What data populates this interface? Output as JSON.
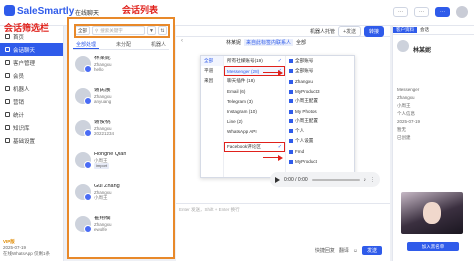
{
  "topbar": {
    "logo": "SaleSmartly",
    "online_tab": "在线聊天",
    "pills": [
      "···",
      "···",
      "···"
    ]
  },
  "sidebar": {
    "items": [
      {
        "label": "首页"
      },
      {
        "label": "会话聊天"
      },
      {
        "label": "客户管理"
      },
      {
        "label": "会员"
      },
      {
        "label": "机器人"
      },
      {
        "label": "营销"
      },
      {
        "label": "统计"
      },
      {
        "label": "知识库"
      },
      {
        "label": "基础设置"
      }
    ],
    "plan_tier": "VIP版",
    "plan_date": "2025-07-19",
    "plan_note": "在线WhatsApp 仅剩1条"
  },
  "annotations": {
    "filter_label": "会话筛选栏",
    "list_label": "会话列表"
  },
  "convlist": {
    "filter_select": "全部",
    "search_placeholder": "搜索关键字",
    "tabs": [
      "全部处理",
      "未分配",
      "机器人"
    ],
    "conversations": [
      {
        "name": "林某妮",
        "line1": "Zhangxu",
        "line2": "hello"
      },
      {
        "name": "谢民展",
        "line1": "Zhangxu",
        "line2": "anyuang"
      },
      {
        "name": "谢俊桃",
        "line1": "Zhangxu",
        "line2": "20221234"
      },
      {
        "name": "Honghe Qian",
        "line1": "小周王",
        "line2": "import"
      },
      {
        "name": "Gui Zhang",
        "line1": "Zhangxu",
        "line2": "小周王"
      },
      {
        "name": "霍翔楠",
        "line1": "Zhangxu",
        "line2": "ewolfe"
      }
    ]
  },
  "chat": {
    "head_items": [
      "机器人托管",
      "+发送",
      "转接"
    ],
    "title_name": "林某妮",
    "title_tag": "来自此标签内联系人",
    "title_tag2": "全部"
  },
  "dropdown": {
    "col1": [
      "全部",
      "平道",
      "来因"
    ],
    "col2": [
      "所有社媒账号(19)",
      "Messenger (28)",
      "聊天插件 (18)",
      "Email (6)",
      "Telegram (3)",
      "Instagram (10)",
      "Line (2)",
      "WhatsApp API",
      "Facebook评论区"
    ],
    "col3": [
      "全部账号",
      "全部账号",
      "Zhangxu",
      "MyProduct3",
      "小周王配置",
      "My Photos",
      "小周王配置",
      "个人",
      "个人设置",
      "Fmd",
      "MyProduct"
    ]
  },
  "audio": {
    "time": "0:00 / 0:00"
  },
  "composer": {
    "placeholder": "Enter 发送，Shift + Enter 换行",
    "tools": [
      "快捷回复",
      "翻译",
      "发送"
    ]
  },
  "rpanel": {
    "tabs": [
      "客户资料",
      "会话"
    ],
    "name": "林某妮",
    "info": [
      "Messenger",
      "Zhangxu",
      "小周王",
      "个人信息",
      "2025-07-19",
      "暂无",
      "已创建"
    ],
    "button": "加入黑名单"
  },
  "colors": {
    "brand": "#2f5bea",
    "annotation": "#e0211b",
    "box": "#e8892a"
  }
}
